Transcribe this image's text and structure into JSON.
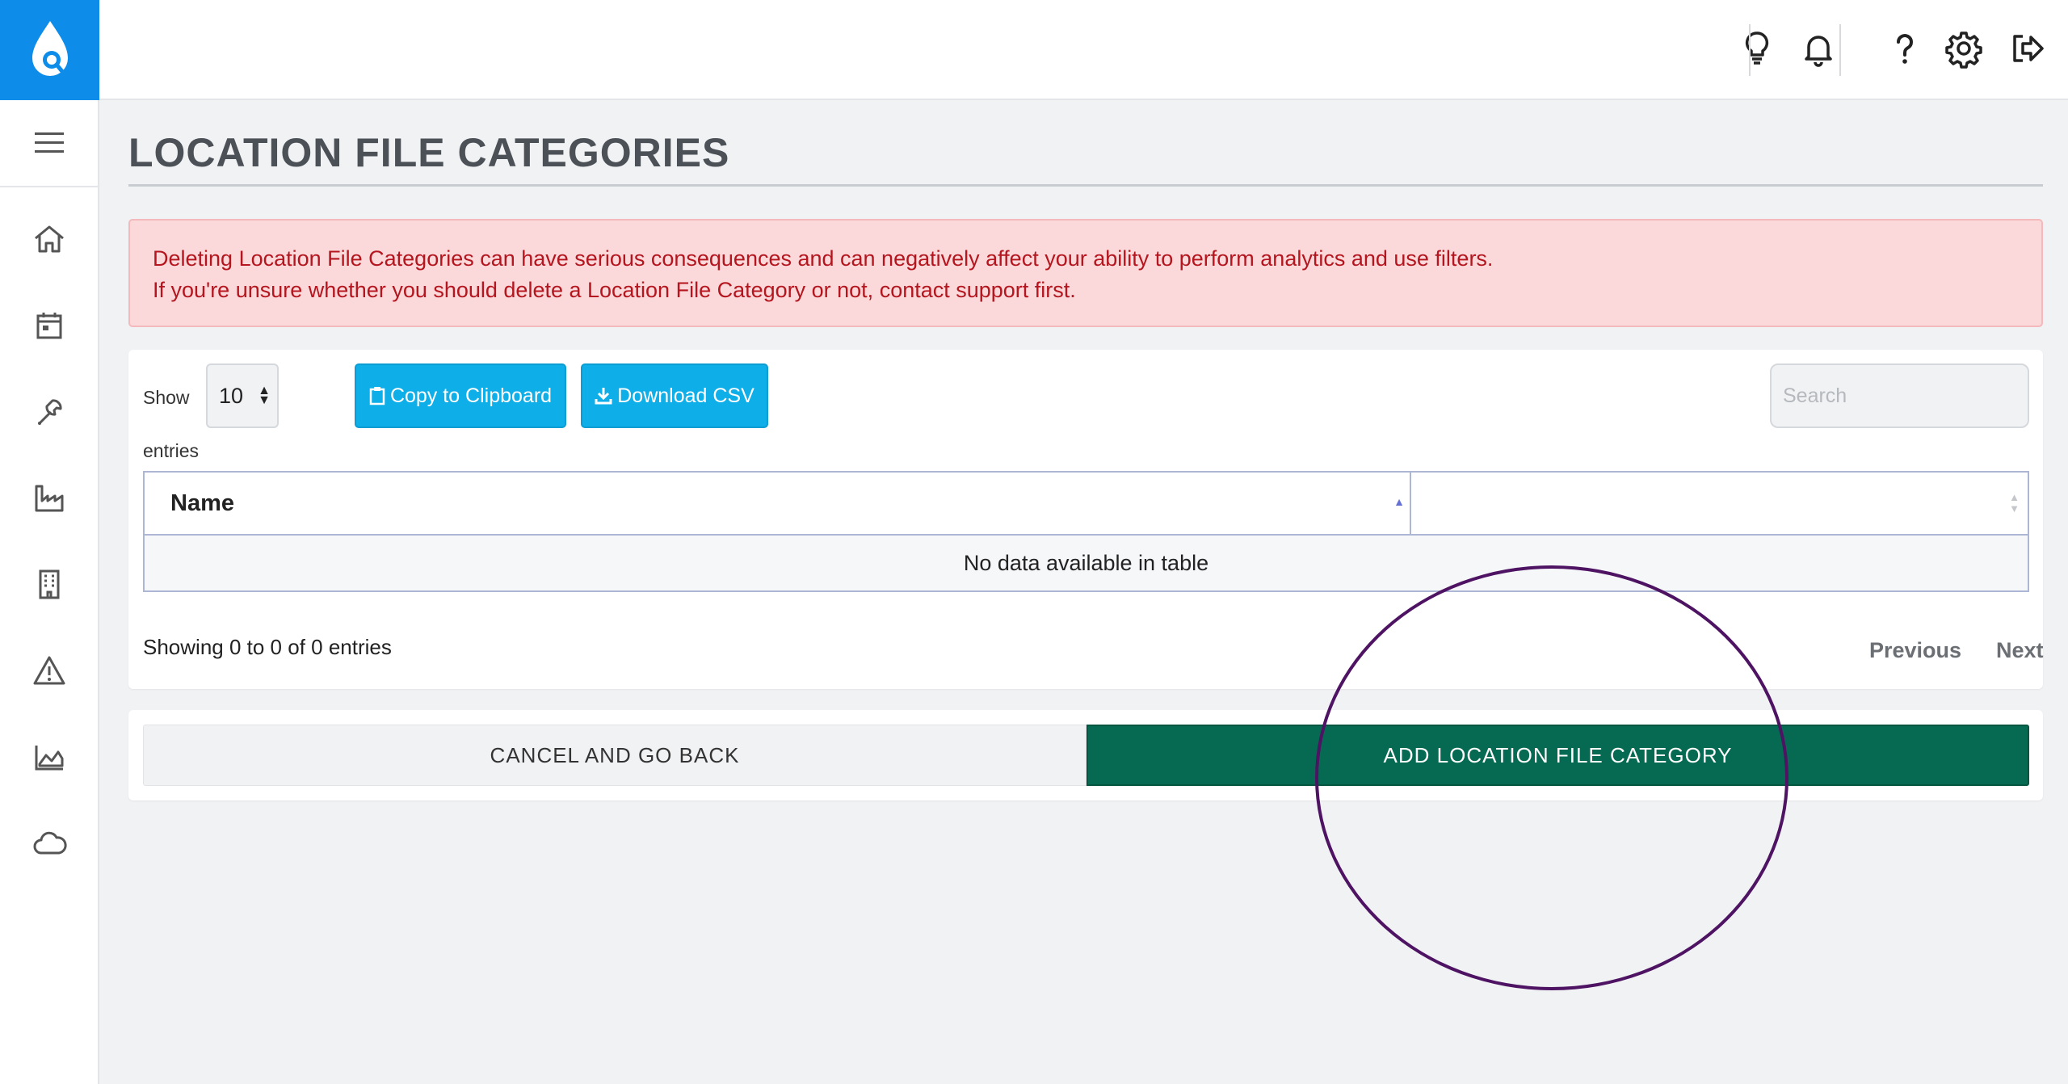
{
  "app": {
    "brand_color": "#0d8de9"
  },
  "sidebar": {
    "items": [
      {
        "icon": "home-icon"
      },
      {
        "icon": "calendar-icon"
      },
      {
        "icon": "wrench-icon"
      },
      {
        "icon": "factory-icon"
      },
      {
        "icon": "building-icon"
      },
      {
        "icon": "warning-icon"
      },
      {
        "icon": "area-chart-icon"
      },
      {
        "icon": "cloud-icon"
      }
    ]
  },
  "header": {
    "icons": [
      "lightbulb-icon",
      "bell-icon",
      "help-icon",
      "gear-icon",
      "logout-icon"
    ]
  },
  "page": {
    "title": "LOCATION FILE CATEGORIES"
  },
  "alert": {
    "line1": "Deleting Location File Categories can have serious consequences and can negatively affect your ability to perform analytics and use filters.",
    "line2": "If you're unsure whether you should delete a Location File Category or not, contact support first."
  },
  "table_controls": {
    "show_label": "Show",
    "entries_value": "10",
    "entries_label": "entries",
    "copy_label": "Copy to Clipboard",
    "csv_label": "Download CSV",
    "search_placeholder": "Search"
  },
  "table": {
    "columns": [
      "Name",
      ""
    ],
    "empty_message": "No data available in table",
    "info": "Showing 0 to 0 of 0 entries",
    "prev_label": "Previous",
    "next_label": "Next"
  },
  "actions": {
    "cancel_label": "CANCEL AND GO BACK",
    "add_label": "ADD LOCATION FILE CATEGORY",
    "add_color": "#066a52"
  },
  "annotation": {
    "color": "#4e1463"
  }
}
